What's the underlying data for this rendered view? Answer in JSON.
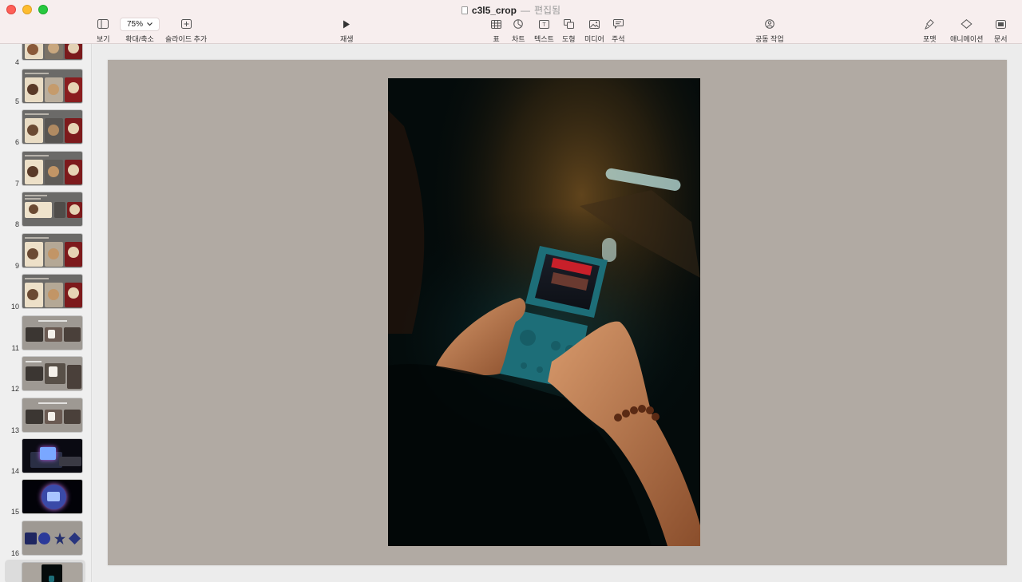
{
  "window": {
    "file_name": "c3l5_crop",
    "separator": "—",
    "status": "편집됨"
  },
  "toolbar": {
    "view_label": "보기",
    "zoom_value": "75%",
    "zoom_label": "확대/축소",
    "add_slide_label": "슬라이드 추가",
    "play_label": "재생",
    "table_label": "표",
    "chart_label": "차트",
    "text_label": "텍스트",
    "shape_label": "도형",
    "media_label": "미디어",
    "comment_label": "주석",
    "collaborate_label": "공동 작업",
    "format_label": "포맷",
    "animate_label": "애니메이션",
    "document_label": "문서"
  },
  "sidebar": {
    "slides": [
      {
        "number": "4",
        "kind": "coffee"
      },
      {
        "number": "5",
        "kind": "coffee"
      },
      {
        "number": "6",
        "kind": "coffee"
      },
      {
        "number": "7",
        "kind": "coffee"
      },
      {
        "number": "8",
        "kind": "coffee"
      },
      {
        "number": "9",
        "kind": "coffee"
      },
      {
        "number": "10",
        "kind": "coffee"
      },
      {
        "number": "11",
        "kind": "hands"
      },
      {
        "number": "12",
        "kind": "hands"
      },
      {
        "number": "13",
        "kind": "hands"
      },
      {
        "number": "14",
        "kind": "neon"
      },
      {
        "number": "15",
        "kind": "neon-circle"
      },
      {
        "number": "16",
        "kind": "neon-row"
      },
      {
        "number": "",
        "kind": "console-selected"
      }
    ]
  },
  "colors": {
    "toolbar_bg": "#f7eeee",
    "slide_bg": "#b1aaa3",
    "photo_bg": "#040b0b",
    "console_teal": "#1d6e78"
  },
  "icons": {
    "view": "sidebar-icon",
    "add_slide": "plus-square-icon",
    "play": "play-icon",
    "table": "table-icon",
    "chart": "chart-icon",
    "text": "text-box-icon",
    "shape": "shape-icon",
    "media": "photo-icon",
    "comment": "comment-icon",
    "collaborate": "collaborate-icon",
    "format": "paintbrush-icon",
    "animate": "diamond-icon",
    "document": "document-icon"
  }
}
